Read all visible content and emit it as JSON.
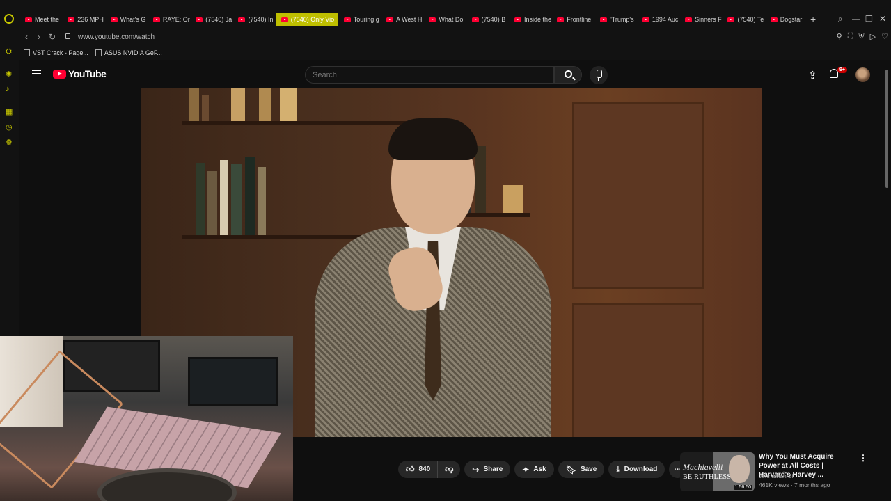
{
  "browser": {
    "tabs": [
      {
        "label": "Meet the"
      },
      {
        "label": "236 MPH"
      },
      {
        "label": "What's G"
      },
      {
        "label": "RAYE: Or"
      },
      {
        "label": "(7540) Ja"
      },
      {
        "label": "(7540) In"
      },
      {
        "label": "(7540) Only Vio",
        "active": true
      },
      {
        "label": "Touring g"
      },
      {
        "label": "A West H"
      },
      {
        "label": "What Do"
      },
      {
        "label": "(7540) B"
      },
      {
        "label": "Inside the"
      },
      {
        "label": "Frontline"
      },
      {
        "label": "\"Trump's"
      },
      {
        "label": "1994 Auc"
      },
      {
        "label": "Sinners F"
      },
      {
        "label": "(7540) Te"
      },
      {
        "label": "Dogstar"
      }
    ],
    "url": "www.youtube.com/watch",
    "bookmarks": [
      {
        "label": "VST Crack - Page..."
      },
      {
        "label": "ASUS NVIDIA GeF..."
      }
    ],
    "accent_color": "#c8c800"
  },
  "youtube": {
    "logo_text": "YouTube",
    "search_placeholder": "Search",
    "notification_count": "9+",
    "actions": {
      "like_count": "840",
      "share": "Share",
      "ask": "Ask",
      "save": "Save",
      "download": "Download"
    },
    "recommendation": {
      "title": "Why You Must Acquire Power at All Costs | Harvard's Harvey ...",
      "channel": "Johnathan Bi",
      "meta": "461K views · 7 months ago",
      "thumb_line1": "Machiavelli",
      "thumb_line2": "BE RUTHLESS",
      "duration": "1:56:50"
    }
  }
}
